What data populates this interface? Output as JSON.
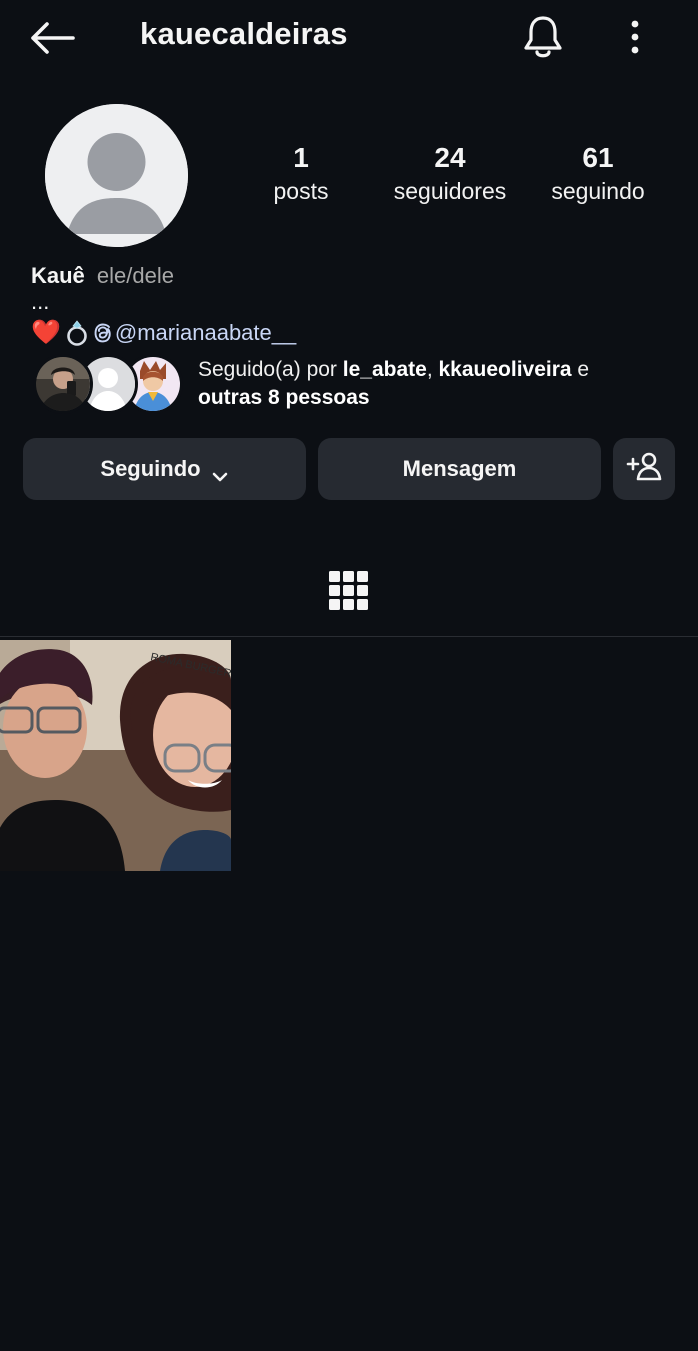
{
  "header": {
    "username": "kauecaldeiras"
  },
  "stats": {
    "posts": {
      "count": "1",
      "label": "posts"
    },
    "followers": {
      "count": "24",
      "label": "seguidores"
    },
    "following": {
      "count": "61",
      "label": "seguindo"
    }
  },
  "bio": {
    "name": "Kauê",
    "pronouns": "ele/dele",
    "dots": "...",
    "heart": "❤️",
    "threads_handle": "@marianaabate__"
  },
  "followed_by": {
    "prefix": "Seguido(a) por ",
    "user1": "le_abate",
    "separator": ", ",
    "user2": "kkaueoliveira",
    "conjunction": " e",
    "others": "outras 8 pessoas"
  },
  "actions": {
    "following_label": "Seguindo",
    "message_label": "Mensagem"
  },
  "icons": {
    "back": "arrow-left-icon",
    "notifications": "bell-icon",
    "more": "more-vertical-icon",
    "add_user": "add-user-icon",
    "grid": "grid-icon"
  },
  "colors": {
    "background": "#0c0f14",
    "button": "#262a31",
    "heart": "#e5252c",
    "mention": "#c9d6f5"
  }
}
